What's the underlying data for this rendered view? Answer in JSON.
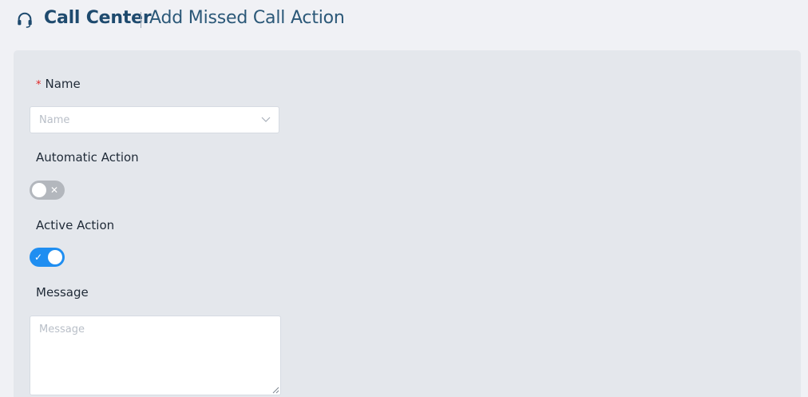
{
  "header": {
    "icon": "headset-icon",
    "title": "Call Center",
    "subtitle": "Add Missed Call Action"
  },
  "form": {
    "name": {
      "required_marker": "*",
      "label": "Name",
      "placeholder": "Name",
      "value": "",
      "icon": "chevron-down-icon"
    },
    "automatic_action": {
      "label": "Automatic Action",
      "checked": false,
      "off_mark": "✕"
    },
    "active_action": {
      "label": "Active Action",
      "checked": true,
      "on_mark": "✓"
    },
    "message": {
      "label": "Message",
      "placeholder": "Message",
      "value": ""
    }
  },
  "colors": {
    "brand": "#1e4a6e",
    "toggle_on": "#1f8ef1",
    "toggle_off": "#b3b7bd",
    "required": "#e02424"
  }
}
